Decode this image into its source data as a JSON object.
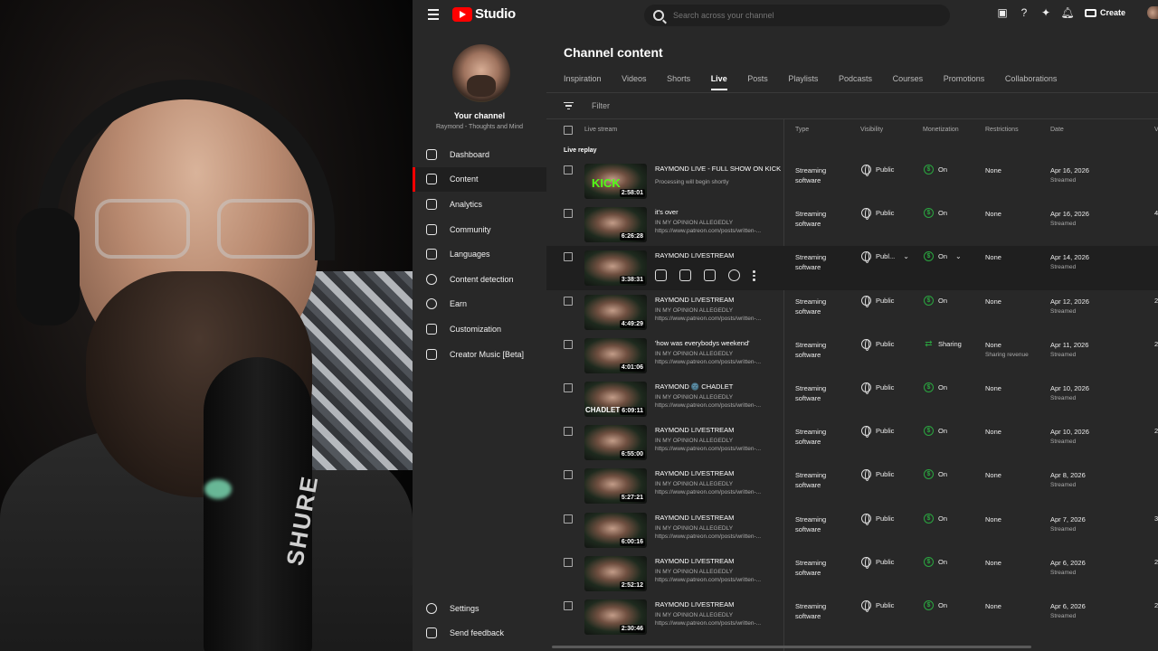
{
  "app": {
    "brand": "Studio"
  },
  "search": {
    "placeholder": "Search across your channel"
  },
  "topbar": {
    "create_label": "Create"
  },
  "channel": {
    "title": "Your channel",
    "name": "Raymond - Thoughts and Mind"
  },
  "sidebar": {
    "items": [
      {
        "label": "Dashboard",
        "icon": "dashboard-icon"
      },
      {
        "label": "Content",
        "icon": "content-icon",
        "active": true
      },
      {
        "label": "Analytics",
        "icon": "analytics-icon"
      },
      {
        "label": "Community",
        "icon": "community-icon"
      },
      {
        "label": "Languages",
        "icon": "languages-icon"
      },
      {
        "label": "Content detection",
        "icon": "copyright-icon"
      },
      {
        "label": "Earn",
        "icon": "dollar-icon"
      },
      {
        "label": "Customization",
        "icon": "magic-wand-icon"
      },
      {
        "label": "Creator Music [Beta]",
        "icon": "music-icon"
      }
    ],
    "bottom": [
      {
        "label": "Settings",
        "icon": "gear-icon"
      },
      {
        "label": "Send feedback",
        "icon": "feedback-icon"
      }
    ]
  },
  "main": {
    "title": "Channel content",
    "tabs": [
      "Inspiration",
      "Videos",
      "Shorts",
      "Live",
      "Posts",
      "Playlists",
      "Podcasts",
      "Courses",
      "Promotions",
      "Collaborations"
    ],
    "active_tab": "Live",
    "filter_placeholder": "Filter",
    "columns": {
      "stream": "Live stream",
      "type": "Type",
      "visibility": "Visibility",
      "monetization": "Monetization",
      "restrictions": "Restrictions",
      "date": "Date",
      "views_partial": "V"
    },
    "section_label": "Live replay"
  },
  "rows": [
    {
      "title": "RAYMOND LIVE - FULL SHOW ON KICK",
      "desc1": "Processing will begin shortly",
      "desc2": "",
      "duration": "2:58:01",
      "type1": "Streaming",
      "type2": "software",
      "visibility": "Public",
      "monetization": "On",
      "restriction": "None",
      "restriction_sub": "",
      "date": "Apr 16, 2026",
      "date_sub": "Streamed",
      "views": "",
      "kick": "KICK"
    },
    {
      "title": "it's over",
      "desc1": "IN MY OPINION ALLEGEDLY",
      "desc2": "https://www.patreon.com/posts/written-...",
      "duration": "6:26:28",
      "type1": "Streaming",
      "type2": "software",
      "visibility": "Public",
      "monetization": "On",
      "restriction": "None",
      "restriction_sub": "",
      "date": "Apr 16, 2026",
      "date_sub": "Streamed",
      "views": "4"
    },
    {
      "title": "RAYMOND LIVESTREAM",
      "desc1": "",
      "desc2": "",
      "duration": "3:38:31",
      "type1": "Streaming",
      "type2": "software",
      "visibility": "Publ...",
      "monetization": "On",
      "restriction": "None",
      "restriction_sub": "",
      "date": "Apr 14, 2026",
      "date_sub": "Streamed",
      "views": "",
      "hover": true
    },
    {
      "title": "RAYMOND LIVESTREAM",
      "desc1": "IN MY OPINION ALLEGEDLY",
      "desc2": "https://www.patreon.com/posts/written-...",
      "duration": "4:49:29",
      "type1": "Streaming",
      "type2": "software",
      "visibility": "Public",
      "monetization": "On",
      "restriction": "None",
      "restriction_sub": "",
      "date": "Apr 12, 2026",
      "date_sub": "Streamed",
      "views": "2"
    },
    {
      "title": "'how was everybodys weekend'",
      "desc1": "IN MY OPINION ALLEGEDLY",
      "desc2": "https://www.patreon.com/posts/written-...",
      "duration": "4:01:06",
      "type1": "Streaming",
      "type2": "software",
      "visibility": "Public",
      "monetization": "Sharing",
      "restriction": "None",
      "restriction_sub": "Sharing revenue",
      "date": "Apr 11, 2026",
      "date_sub": "Streamed",
      "views": "2",
      "sharing": true
    },
    {
      "title": "RAYMOND 🌚 CHADLET",
      "desc1": "IN MY OPINION ALLEGEDLY",
      "desc2": "https://www.patreon.com/posts/written-...",
      "duration": "6:09:11",
      "type1": "Streaming",
      "type2": "software",
      "visibility": "Public",
      "monetization": "On",
      "restriction": "None",
      "restriction_sub": "",
      "date": "Apr 10, 2026",
      "date_sub": "Streamed",
      "views": "",
      "chadlet": "CHADLET"
    },
    {
      "title": "RAYMOND LIVESTREAM",
      "desc1": "IN MY OPINION ALLEGEDLY",
      "desc2": "https://www.patreon.com/posts/written-...",
      "duration": "6:55:00",
      "type1": "Streaming",
      "type2": "software",
      "visibility": "Public",
      "monetization": "On",
      "restriction": "None",
      "restriction_sub": "",
      "date": "Apr 10, 2026",
      "date_sub": "Streamed",
      "views": "2"
    },
    {
      "title": "RAYMOND LIVESTREAM",
      "desc1": "IN MY OPINION ALLEGEDLY",
      "desc2": "https://www.patreon.com/posts/written-...",
      "duration": "5:27:21",
      "type1": "Streaming",
      "type2": "software",
      "visibility": "Public",
      "monetization": "On",
      "restriction": "None",
      "restriction_sub": "",
      "date": "Apr 8, 2026",
      "date_sub": "Streamed",
      "views": ""
    },
    {
      "title": "RAYMOND LIVESTREAM",
      "desc1": "IN MY OPINION ALLEGEDLY",
      "desc2": "https://www.patreon.com/posts/written-...",
      "duration": "6:00:16",
      "type1": "Streaming",
      "type2": "software",
      "visibility": "Public",
      "monetization": "On",
      "restriction": "None",
      "restriction_sub": "",
      "date": "Apr 7, 2026",
      "date_sub": "Streamed",
      "views": "3"
    },
    {
      "title": "RAYMOND LIVESTREAM",
      "desc1": "IN MY OPINION ALLEGEDLY",
      "desc2": "https://www.patreon.com/posts/written-...",
      "duration": "2:52:12",
      "type1": "Streaming",
      "type2": "software",
      "visibility": "Public",
      "monetization": "On",
      "restriction": "None",
      "restriction_sub": "",
      "date": "Apr 6, 2026",
      "date_sub": "Streamed",
      "views": "2"
    },
    {
      "title": "RAYMOND LIVESTREAM",
      "desc1": "IN MY OPINION ALLEGEDLY",
      "desc2": "https://www.patreon.com/posts/written-...",
      "duration": "2:30:46",
      "type1": "Streaming",
      "type2": "software",
      "visibility": "Public",
      "monetization": "On",
      "restriction": "None",
      "restriction_sub": "",
      "date": "Apr 6, 2026",
      "date_sub": "Streamed",
      "views": "2"
    }
  ],
  "webcam": {
    "mic_brand": "SHURE"
  },
  "colors": {
    "brand_red": "#ff0000",
    "monetization_green": "#2ba640",
    "bg": "#282828"
  }
}
